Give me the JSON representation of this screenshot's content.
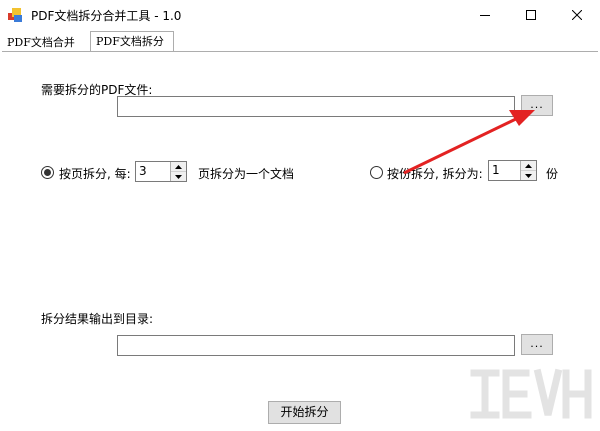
{
  "window": {
    "title": "PDF文档拆分合并工具 - 1.0"
  },
  "tabs": [
    {
      "label": "PDF文档合并"
    },
    {
      "label": "PDF文档拆分"
    }
  ],
  "split": {
    "source_label": "需要拆分的PDF文件:",
    "source_value": "",
    "browse_label": "...",
    "by_page_label": "按页拆分, 每:",
    "by_page_value": "3",
    "by_page_suffix": "页拆分为一个文档",
    "by_count_label": "按份拆分, 拆分为:",
    "by_count_value": "1",
    "by_count_suffix": "份",
    "by_page_selected": true,
    "output_label": "拆分结果输出到目录:",
    "output_value": "",
    "output_browse_label": "...",
    "start_label": "开始拆分"
  },
  "colors": {
    "annotation_arrow": "#e32222",
    "watermark": "#e3e3e3"
  },
  "icons": [
    "app-icon",
    "minimize-icon",
    "maximize-icon",
    "close-icon",
    "spin-up-icon",
    "spin-down-icon"
  ]
}
